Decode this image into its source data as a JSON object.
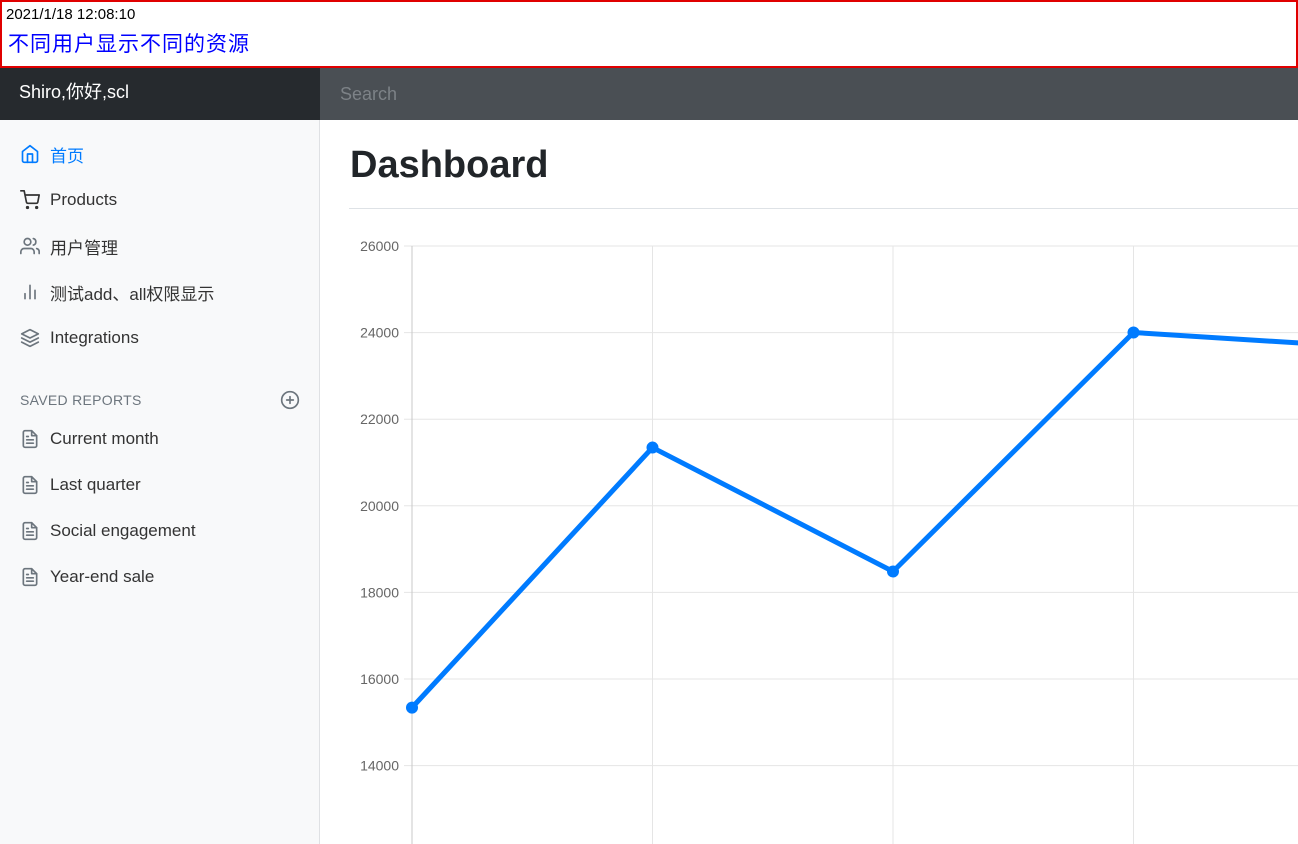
{
  "banner": {
    "timestamp": "2021/1/18 12:08:10",
    "message": "不同用户显示不同的资源"
  },
  "navbar": {
    "brand": "Shiro,你好,scl",
    "search_placeholder": "Search"
  },
  "sidebar": {
    "items": [
      {
        "label": "首页",
        "icon": "home-icon",
        "active": true
      },
      {
        "label": "Products",
        "icon": "shopping-cart-icon",
        "active": false
      },
      {
        "label": "用户管理",
        "icon": "users-icon",
        "active": false
      },
      {
        "label": "测试add、all权限显示",
        "icon": "bar-chart-icon",
        "active": false
      },
      {
        "label": "Integrations",
        "icon": "layers-icon",
        "active": false
      }
    ],
    "saved_reports_header": "SAVED REPORTS",
    "reports": [
      {
        "label": "Current month",
        "icon": "file-text-icon"
      },
      {
        "label": "Last quarter",
        "icon": "file-text-icon"
      },
      {
        "label": "Social engagement",
        "icon": "file-text-icon"
      },
      {
        "label": "Year-end sale",
        "icon": "file-text-icon"
      }
    ]
  },
  "main": {
    "title": "Dashboard"
  },
  "colors": {
    "accent": "#007bff",
    "banner_border": "#e00000",
    "banner_text": "#0000ff",
    "navbar": "#4a4f54",
    "brand_bg": "#262a2e"
  },
  "chart_data": {
    "type": "line",
    "y_ticks": [
      14000,
      16000,
      18000,
      20000,
      22000,
      24000,
      26000
    ],
    "values": [
      15339,
      21345,
      18483,
      24003,
      23650
    ],
    "grid": true,
    "color": "#007bff"
  }
}
